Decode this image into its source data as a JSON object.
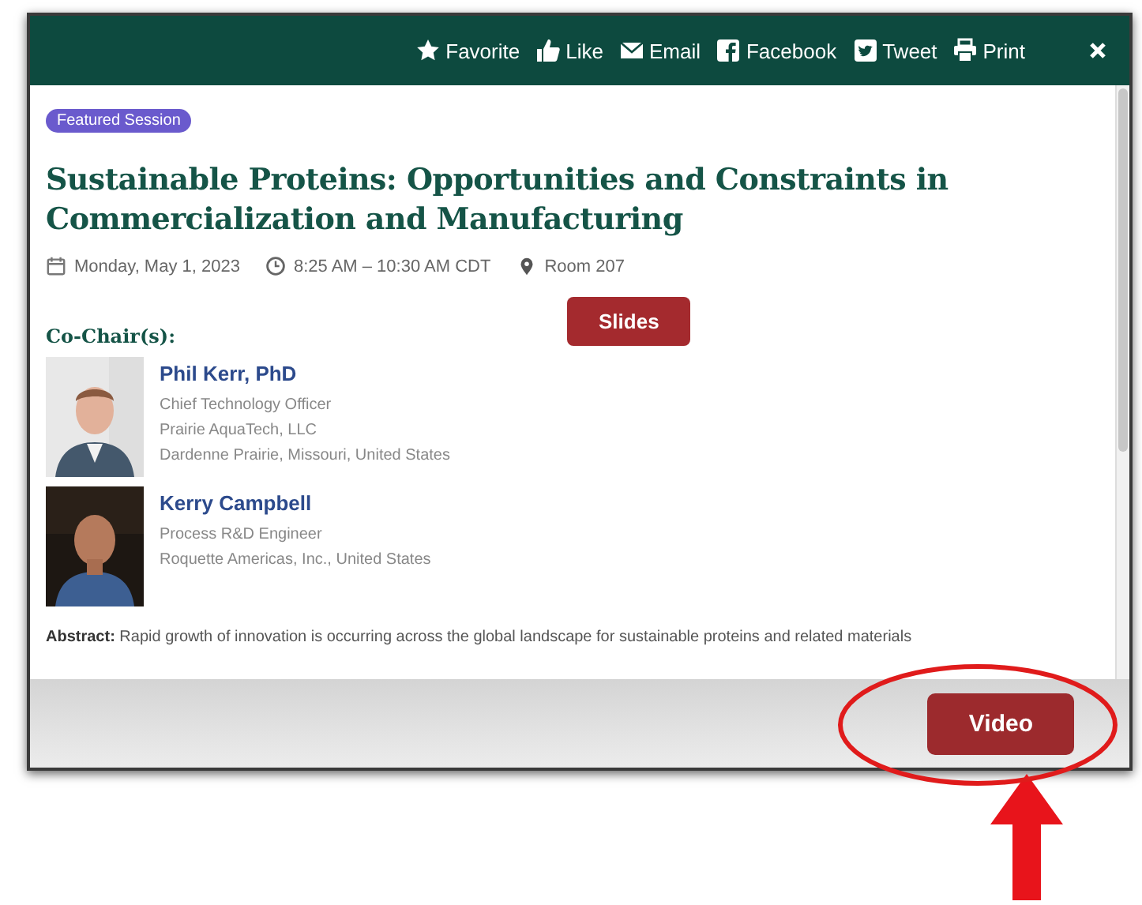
{
  "toolbar": {
    "actions": [
      {
        "kind": "star",
        "label": "Favorite"
      },
      {
        "kind": "thumb",
        "label": "Like"
      },
      {
        "kind": "mail",
        "label": "Email"
      },
      {
        "kind": "facebook",
        "label": "Facebook"
      },
      {
        "kind": "twitter",
        "label": "Tweet"
      },
      {
        "kind": "print",
        "label": "Print"
      }
    ]
  },
  "session": {
    "badge": "Featured Session",
    "title": "Sustainable Proteins: Opportunities and Constraints in Commercialization and Manufacturing",
    "date": "Monday, May 1, 2023",
    "time": "8:25 AM – 10:30 AM CDT",
    "room": "Room 207",
    "slides_button": "Slides",
    "people_heading": "Co-Chair(s):",
    "people": [
      {
        "name": "Phil Kerr, PhD",
        "lines": [
          "Chief Technology Officer",
          "Prairie AquaTech, LLC",
          "Dardenne Prairie, Missouri, United States"
        ]
      },
      {
        "name": "Kerry Campbell",
        "lines": [
          "Process R&D Engineer",
          "Roquette Americas, Inc., United States"
        ]
      }
    ],
    "abstract": "**Abstract:** Rapid growth of innovation is occurring across the global landscape for sustainable proteins and related materials"
  },
  "footer": {
    "button": "Video",
    "highlighted": true
  }
}
